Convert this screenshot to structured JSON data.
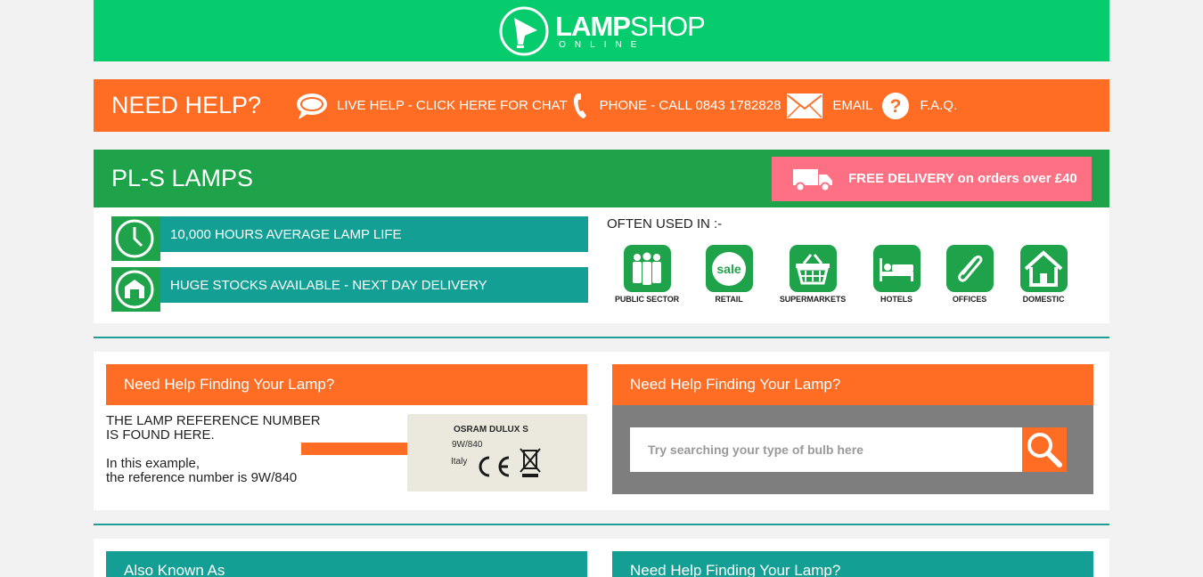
{
  "header": {
    "logo_word_bold": "LAMP",
    "logo_word_light": "SHOP",
    "logo_sub": "ONLINE",
    "bg_color": "#06cc6e"
  },
  "help_bar": {
    "title": "NEED HELP?",
    "live_help": "LIVE HELP - CLICK HERE FOR CHAT",
    "phone": "PHONE - CALL 0843 1782828",
    "email": "EMAIL",
    "faq": "F.A.Q.",
    "bg_color": "#ff6d25"
  },
  "category": {
    "title": "PL-S LAMPS",
    "delivery_text": "FREE DELIVERY on orders  over £40",
    "bg_color": "#1fa34a",
    "delivery_color": "#fe7084"
  },
  "features": [
    {
      "label": "10,000 HOURS AVERAGE LAMP LIFE",
      "icon": "clock-icon"
    },
    {
      "label": "HUGE STOCKS AVAILABLE - NEXT DAY DELIVERY",
      "icon": "warehouse-icon"
    }
  ],
  "often_used": {
    "title": "OFTEN USED IN :-",
    "sectors": [
      {
        "label": "PUBLIC SECTOR",
        "icon": "people-icon"
      },
      {
        "label": "RETAIL",
        "icon": "sale-tag-icon"
      },
      {
        "label": "SUPERMARKETS",
        "icon": "basket-icon"
      },
      {
        "label": "HOTELS",
        "icon": "bed-icon"
      },
      {
        "label": "OFFICES",
        "icon": "paperclip-icon"
      },
      {
        "label": "DOMESTIC",
        "icon": "house-icon"
      }
    ]
  },
  "finder": {
    "left_heading": "Need Help Finding Your Lamp?",
    "ref_line1": "THE LAMP REFERENCE NUMBER",
    "ref_line2": "IS FOUND HERE.",
    "example_line1": "In this example,",
    "example_line2": "the reference number is 9W/840",
    "label_brand": "OSRAM DULUX S",
    "label_code": "9W/840",
    "label_origin": "Italy",
    "right_heading": "Need Help Finding Your Lamp?",
    "search_placeholder": "Try searching your type of bulb here"
  },
  "bottom": {
    "left_heading": "Also Known As",
    "right_heading": "Need Help Finding Your Lamp?"
  }
}
